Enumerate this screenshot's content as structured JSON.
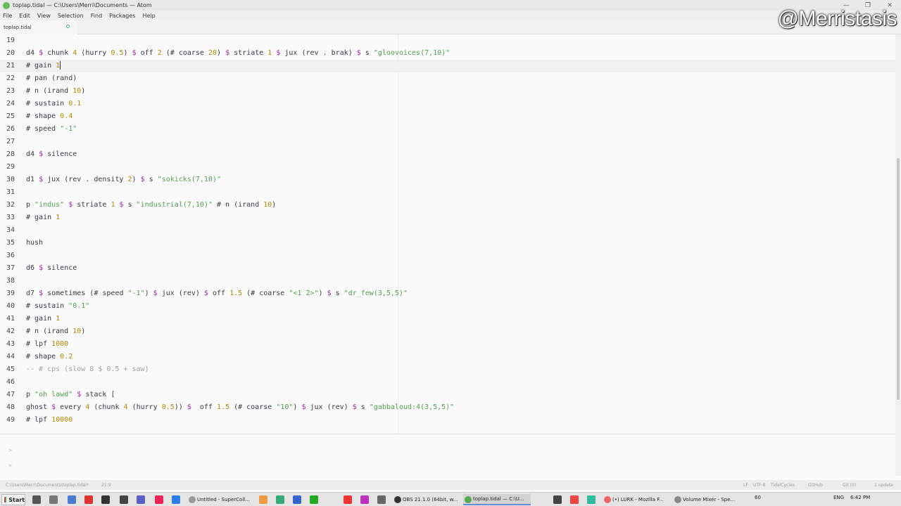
{
  "window": {
    "title": "toplap.tidal — C:\\Users\\Merri\\Documents — Atom",
    "minimize_glyph": "—",
    "maximize_glyph": "❐",
    "close_glyph": "✕"
  },
  "menu": [
    "File",
    "Edit",
    "View",
    "Selection",
    "Find",
    "Packages",
    "Help"
  ],
  "tab": {
    "label": "toplap.tidal"
  },
  "watermark": "@Merristasis",
  "editor": {
    "cursor_line": 21,
    "lines": [
      {
        "n": "19",
        "code": ""
      },
      {
        "n": "20",
        "code": "d4 $ chunk 4 (hurry 0.5) $ off 2 (# coarse 20) $ striate 1 $ jux (rev . brak) $ s \"gloovoices(7,10)\""
      },
      {
        "n": "21",
        "code": "# gain 1"
      },
      {
        "n": "22",
        "code": "# pan (rand)"
      },
      {
        "n": "23",
        "code": "# n (irand 10)"
      },
      {
        "n": "24",
        "code": "# sustain 0.1"
      },
      {
        "n": "25",
        "code": "# shape 0.4"
      },
      {
        "n": "26",
        "code": "# speed \"-1\""
      },
      {
        "n": "27",
        "code": ""
      },
      {
        "n": "28",
        "code": "d4 $ silence"
      },
      {
        "n": "29",
        "code": ""
      },
      {
        "n": "30",
        "code": "d1 $ jux (rev . density 2) $ s \"sokicks(7,10)\""
      },
      {
        "n": "31",
        "code": ""
      },
      {
        "n": "32",
        "code": "p \"indus\" $ striate 1 $ s \"industrial(7,10)\" # n (irand 10)"
      },
      {
        "n": "33",
        "code": "# gain 1"
      },
      {
        "n": "34",
        "code": ""
      },
      {
        "n": "35",
        "code": "hush"
      },
      {
        "n": "36",
        "code": ""
      },
      {
        "n": "37",
        "code": "d6 $ silence"
      },
      {
        "n": "38",
        "code": ""
      },
      {
        "n": "39",
        "code": "d7 $ sometimes (# speed \"-1\") $ jux (rev) $ off 1.5 (# coarse \"<1 2>\") $ s \"dr_few(3,5,5)\""
      },
      {
        "n": "40",
        "code": "# sustain \"0.1\""
      },
      {
        "n": "41",
        "code": "# gain 1"
      },
      {
        "n": "42",
        "code": "# n (irand 10)"
      },
      {
        "n": "43",
        "code": "# lpf 1000"
      },
      {
        "n": "44",
        "code": "# shape 0.2"
      },
      {
        "n": "45",
        "code": "-- # cps (slow 8 $ 0.5 + saw)"
      },
      {
        "n": "46",
        "code": ""
      },
      {
        "n": "47",
        "code": "p \"oh lawd\" $ stack ["
      },
      {
        "n": "48",
        "code": "ghost $ every 4 (chunk 4 (hurry 0.5)) $  off 1.5 (# coarse \"10\") $ jux (rev) $ s \"gabbaloud:4(3,5,5)\""
      },
      {
        "n": "49",
        "code": "# lpf 10000"
      }
    ]
  },
  "console": {
    "prompts": [
      ">",
      ">"
    ]
  },
  "status": {
    "path": "C:\\Users\\Merri\\Documents\\toplap.tidal*",
    "position": "21:9",
    "line_ending": "LF",
    "encoding": "UTF-8",
    "grammar": "TidalCycles",
    "github": "GitHub",
    "git": "Git (0)",
    "update": "1 update"
  },
  "taskbar": {
    "start_label": "Start",
    "items": [
      {
        "label": "Untitled - SuperColl..."
      },
      {
        "label": "OBS 21.1.0 (64bit, w..."
      },
      {
        "label": "toplap.tidal — C:\\U..."
      },
      {
        "label": "(•) LURK - Mozilla F..."
      },
      {
        "label": "Volume Mixer - Spe..."
      }
    ],
    "tray": {
      "volume": "60",
      "lang": "ENG",
      "time": "6:42 PM"
    }
  },
  "colors": {
    "keyword": "#383a42",
    "number": "#b58900",
    "string": "#50a14f",
    "operator": "#a626a4",
    "comment": "#a0a1a7"
  }
}
